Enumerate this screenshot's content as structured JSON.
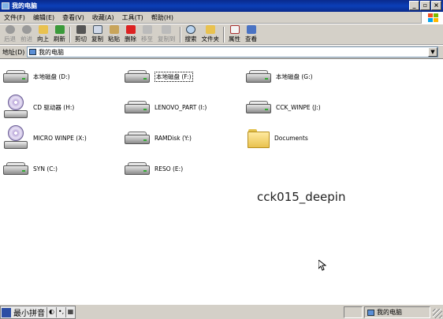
{
  "window": {
    "title": "我的电脑"
  },
  "menu": [
    "文件(F)",
    "编辑(E)",
    "查看(V)",
    "收藏(A)",
    "工具(T)",
    "帮助(H)"
  ],
  "toolbar": {
    "back": "后退",
    "forward": "前进",
    "up": "向上",
    "refresh": "刷新",
    "cut": "剪切",
    "copy": "复制",
    "paste": "粘贴",
    "delete": "删除",
    "move_to": "移至",
    "copy_to": "复制到",
    "search": "搜索",
    "folders": "文件夹",
    "properties": "属性",
    "views": "查看"
  },
  "address": {
    "label": "地址(D)",
    "value": "我的电脑"
  },
  "items": [
    {
      "label": "本地磁盘 (D:)",
      "type": "drive"
    },
    {
      "label": "本地磁盘 (F:)",
      "type": "drive",
      "selected": true
    },
    {
      "label": "本地磁盘 (G:)",
      "type": "drive"
    },
    {
      "label": "CD 驱动器 (H:)",
      "type": "cd"
    },
    {
      "label": "LENOVO_PART (I:)",
      "type": "drive"
    },
    {
      "label": "CCK_WINPE (J:)",
      "type": "drive"
    },
    {
      "label": "MICRO WINPE (X:)",
      "type": "cd"
    },
    {
      "label": "RAMDisk (Y:)",
      "type": "drive"
    },
    {
      "label": "Documents",
      "type": "folder"
    },
    {
      "label": "SYN (C:)",
      "type": "drive"
    },
    {
      "label": "RESO (E:)",
      "type": "drive"
    }
  ],
  "watermark": "cck015_deepin",
  "ime": {
    "name": "最小拼音"
  },
  "status": {
    "location": "我的电脑"
  },
  "colors": {
    "titlebar": "#0a2a8c",
    "chrome": "#d4d0c8",
    "folder": "#e9c24f"
  }
}
